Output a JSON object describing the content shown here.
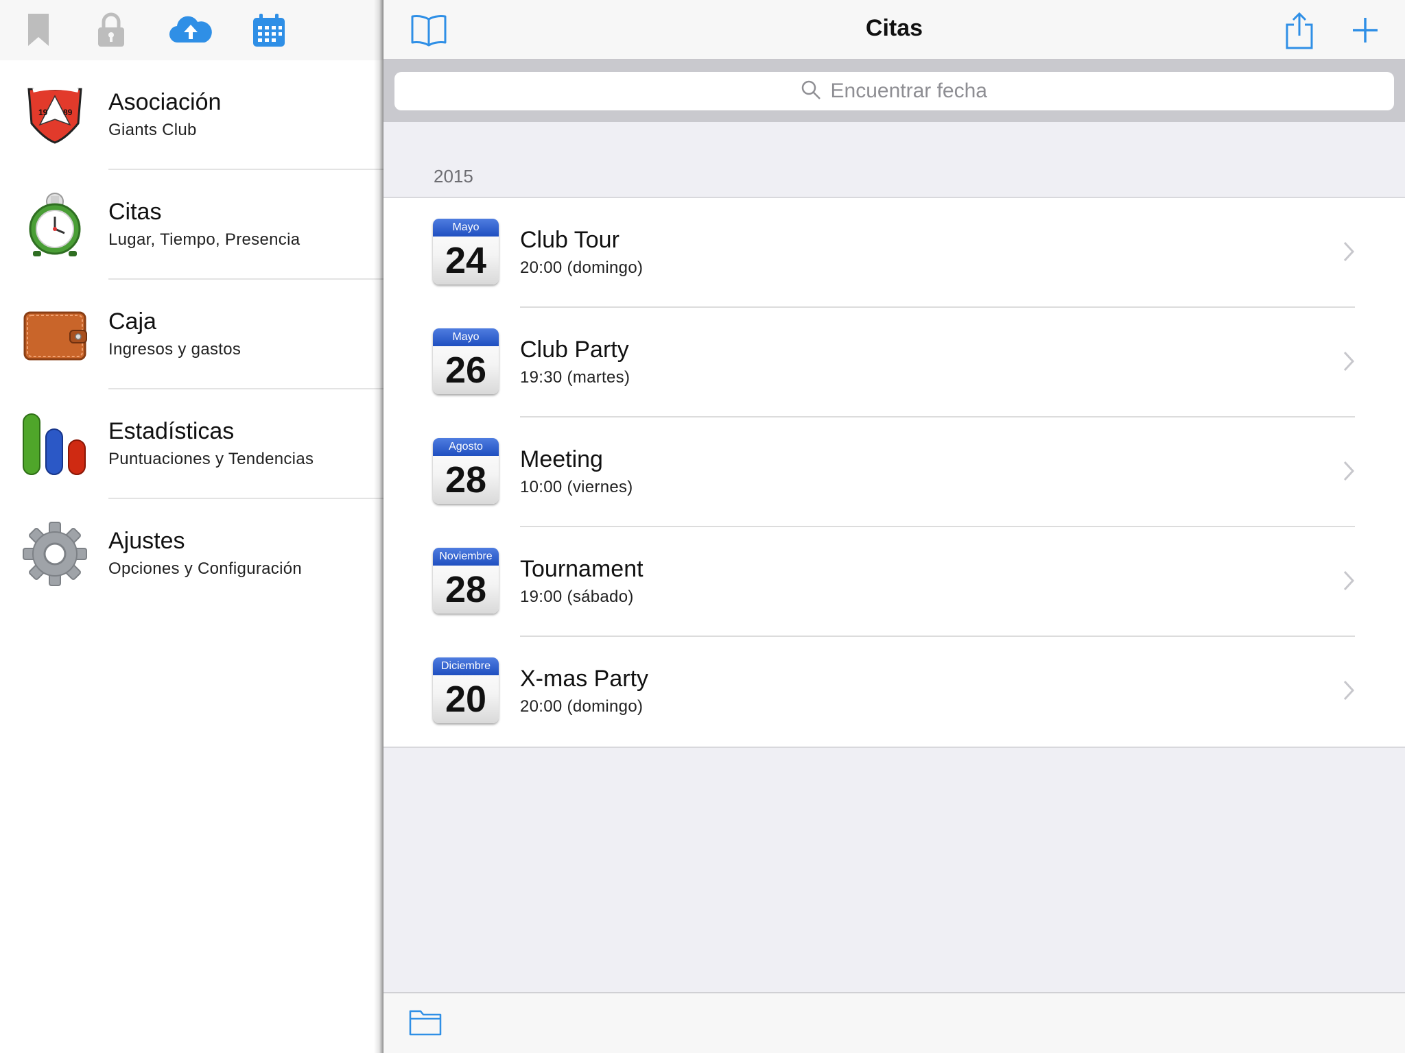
{
  "sidebar": {
    "toolbar": {
      "icons": [
        "bookmark-icon",
        "lock-icon",
        "cloud-upload-icon",
        "calendar-icon"
      ]
    },
    "items": [
      {
        "title": "Asociación",
        "subtitle": "Giants Club",
        "icon": "club-badge-icon"
      },
      {
        "title": "Citas",
        "subtitle": "Lugar, Tiempo, Presencia",
        "icon": "alarm-clock-icon"
      },
      {
        "title": "Caja",
        "subtitle": "Ingresos y gastos",
        "icon": "wallet-icon"
      },
      {
        "title": "Estadísticas",
        "subtitle": "Puntuaciones y Tendencias",
        "icon": "bar-chart-icon"
      },
      {
        "title": "Ajustes",
        "subtitle": "Opciones y Configuración",
        "icon": "gear-icon"
      }
    ],
    "badge": {
      "year_left": "19",
      "year_right": "89"
    }
  },
  "main": {
    "title": "Citas",
    "search": {
      "placeholder": "Encuentrar fecha",
      "value": ""
    },
    "section_header": "2015",
    "appointments": [
      {
        "month": "Mayo",
        "day": "24",
        "title": "Club Tour",
        "time": "20:00 (domingo)"
      },
      {
        "month": "Mayo",
        "day": "26",
        "title": "Club Party",
        "time": "19:30 (martes)"
      },
      {
        "month": "Agosto",
        "day": "28",
        "title": "Meeting",
        "time": "10:00 (viernes)"
      },
      {
        "month": "Noviembre",
        "day": "28",
        "title": "Tournament",
        "time": "19:00 (sábado)"
      },
      {
        "month": "Diciembre",
        "day": "20",
        "title": "X-mas Party",
        "time": "20:00 (domingo)"
      }
    ]
  },
  "colors": {
    "accent": "#2f8fe6",
    "toolbar_icon_gray": "#b5b5b5",
    "calendar_header": "#2e5fd0",
    "background_gray": "#efeff4"
  }
}
